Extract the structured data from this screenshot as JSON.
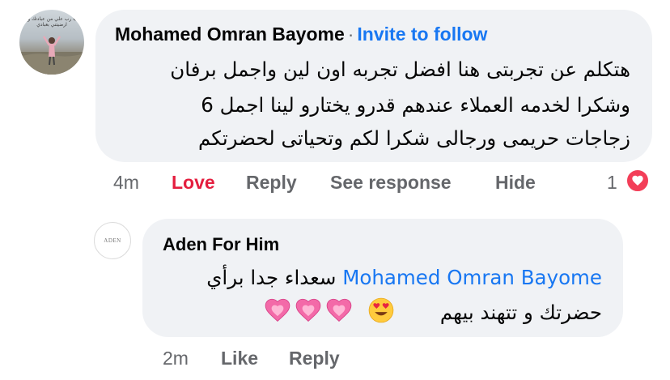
{
  "comment": {
    "author": "Mohamed Omran Bayome",
    "separator": "·",
    "invite_label": "Invite to follow",
    "avatar_caption": "يا رب علي من عبادتك و ارضيتني بعبادي",
    "text_lines": [
      "هتكلم عن تجربتى هنا افضل تجربه اون لين واجمل برفان",
      "وشكرا  لخدمه العملاء عندهم قدرو يختارو لينا اجمل 6",
      "زجاجات حريمى ورجالى شكرا لكم وتحياتى لحضرتكم"
    ],
    "time": "4m",
    "actions": {
      "love": "Love",
      "reply": "Reply",
      "see_response": "See response",
      "hide": "Hide"
    },
    "reaction_count": "1",
    "reaction_icon": "heart-icon",
    "accent_color": "#1877f2",
    "love_color": "#e41e3f"
  },
  "reply": {
    "author": "Aden For Him",
    "avatar_logo": "ADEN",
    "mention": "Mohamed Omran Bayome",
    "text_after_mention": " سعداء جدا برأي",
    "line2": "حضرتك و تتهند بيهم",
    "emojis": [
      "heart-eyes-emoji",
      "pink-heart-emoji",
      "pink-heart-emoji",
      "pink-heart-emoji"
    ],
    "time": "2m",
    "actions": {
      "like": "Like",
      "reply": "Reply"
    }
  }
}
